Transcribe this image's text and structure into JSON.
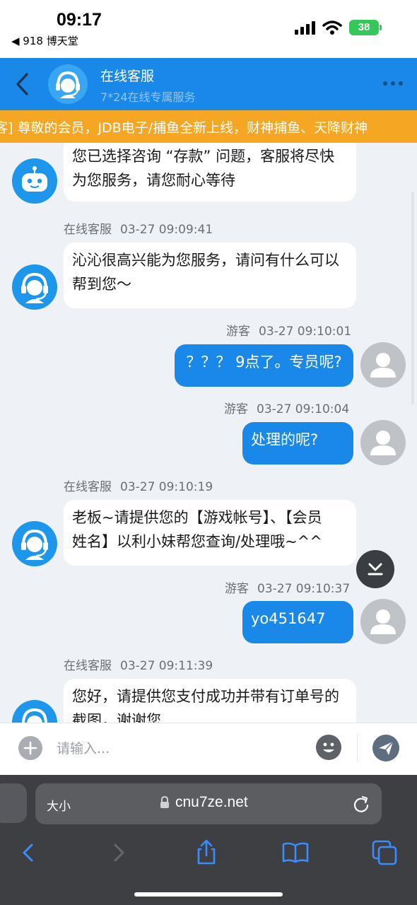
{
  "status_bar": {
    "time": "09:17",
    "back_app": "◀ 918 博天堂",
    "battery": "38"
  },
  "header": {
    "title": "在线客服",
    "subtitle": "7*24在线专属服务"
  },
  "marquee": {
    "text": "客] 尊敬的会员，JDB电子/捕鱼全新上线，财神捕鱼、天降财神"
  },
  "messages": [
    {
      "from": "bot",
      "text_lines": [
        "您已选择咨询 “存款” 问题，客服将尽快",
        "为您服务，请您耐心等待"
      ]
    },
    {
      "from": "agent",
      "sender": "在线客服",
      "time": "03-27 09:09:41",
      "text_lines": [
        "沁沁很高兴能为您服务，请问有什么可以",
        "帮到您～"
      ]
    },
    {
      "from": "user",
      "sender": "游客",
      "time": "03-27 09:10:01",
      "text": "？？？ 9点了。专员呢?"
    },
    {
      "from": "user",
      "sender": "游客",
      "time": "03-27 09:10:04",
      "text": "处理的呢?"
    },
    {
      "from": "agent",
      "sender": "在线客服",
      "time": "03-27 09:10:19",
      "text_lines": [
        "老板~请提供您的【游戏帐号】、【会员",
        "姓名】以利小妹帮您查询/处理哦~^^"
      ]
    },
    {
      "from": "user",
      "sender": "游客",
      "time": "03-27 09:10:37",
      "text": "yo451647"
    },
    {
      "from": "agent",
      "sender": "在线客服",
      "time": "03-27 09:11:39",
      "text_lines": [
        "您好，请提供您支付成功并带有订单号的",
        "截图，谢谢您"
      ]
    }
  ],
  "input": {
    "placeholder": "请输入..."
  },
  "browser": {
    "text_size_label": "大小",
    "url": "cnu7ze.net"
  },
  "colors": {
    "brand_blue": "#1a88e8",
    "marquee_orange": "#f5a623",
    "chat_bg": "#eef2f7",
    "battery_green": "#34c759"
  },
  "icons": {
    "back": "chevron-left-icon",
    "more": "more-dots-icon",
    "add": "plus-circle-icon",
    "emoji": "emoji-icon",
    "send": "send-icon",
    "scroll_down": "scroll-down-icon",
    "lock": "lock-icon",
    "reload": "reload-icon",
    "share": "share-icon",
    "bookmarks": "book-icon",
    "tabs": "tabs-icon"
  }
}
